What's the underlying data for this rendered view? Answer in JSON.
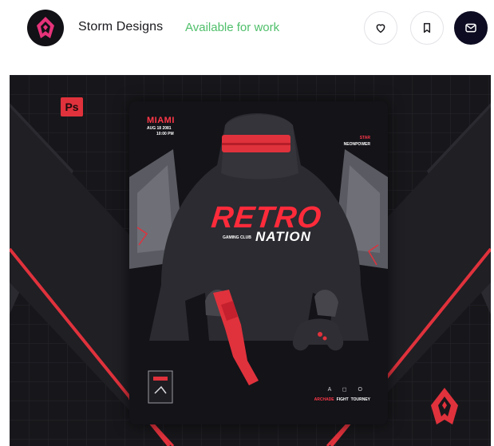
{
  "header": {
    "shop_name": "Storm Designs",
    "status": "Available for work",
    "buttons": [
      {
        "name": "like-button",
        "icon": "heart-icon"
      },
      {
        "name": "save-button",
        "icon": "bookmark-icon"
      },
      {
        "name": "message-button",
        "icon": "mail-icon"
      }
    ]
  },
  "shot": {
    "ps_badge": "Ps",
    "poster": {
      "city": "MIAMI",
      "date": "AUG 18 2081",
      "time": "10:00 PM",
      "top_right_1": "STAR",
      "top_right_2": "NEONPOWER",
      "title_1": "RETRO",
      "club": "GAMING CLUB",
      "title_2": "NATION",
      "bottom_icons": "A ◻ O",
      "bottom_1": "ARCHADE",
      "bottom_2": "FIGHT",
      "bottom_3": "TOURNEY"
    }
  },
  "colors": {
    "accent_red": "#e0323c",
    "status_green": "#4fbf6a",
    "dark_button": "#0d0c22"
  }
}
